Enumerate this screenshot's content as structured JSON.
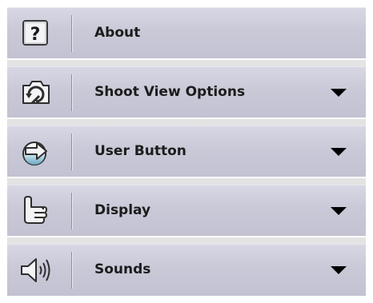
{
  "menu": {
    "items": [
      {
        "label": "About",
        "icon": "help-icon",
        "has_dropdown": false
      },
      {
        "label": "Shoot View Options",
        "icon": "camera-rotate-icon",
        "has_dropdown": true
      },
      {
        "label": "User Button",
        "icon": "arrow-button-icon",
        "has_dropdown": true
      },
      {
        "label": "Display",
        "icon": "pointing-hand-icon",
        "has_dropdown": true
      },
      {
        "label": "Sounds",
        "icon": "speaker-icon",
        "has_dropdown": true
      }
    ]
  },
  "colors": {
    "item_background": "#c9c9d8",
    "separator": "#ffffff",
    "text": "#1c1c1c",
    "dropdown_arrow": "#000000"
  }
}
